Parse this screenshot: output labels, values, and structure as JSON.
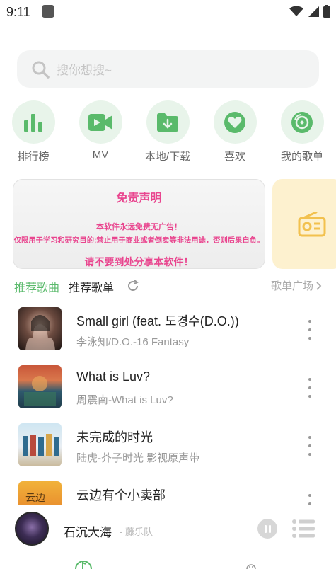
{
  "status_bar": {
    "time": "9:11"
  },
  "search": {
    "placeholder": "搜你想搜~"
  },
  "quick_actions": [
    {
      "label": "排行榜",
      "icon": "bar-chart-icon"
    },
    {
      "label": "MV",
      "icon": "video-camera-icon"
    },
    {
      "label": "本地/下载",
      "icon": "download-folder-icon"
    },
    {
      "label": "喜欢",
      "icon": "heart-icon"
    },
    {
      "label": "我的歌单",
      "icon": "playlist-disc-icon"
    }
  ],
  "banner": {
    "title": "免责声明",
    "line1": "本软件永远免费无广告！",
    "line2": "仅限用于学习和研究目的;禁止用于商业或者倒卖等非法用途，否则后果自负。",
    "footer": "请不要到处分享本软件！"
  },
  "section": {
    "tab_songs": "推荐歌曲",
    "tab_playlists": "推荐歌单",
    "more": "歌单广场"
  },
  "songs": [
    {
      "title": "Small girl (feat. 도경수(D.O.))",
      "subtitle": "李泳知/D.O.-16 Fantasy"
    },
    {
      "title": "What is Luv?",
      "subtitle": "周震南-What is Luv?"
    },
    {
      "title": "未完成的时光",
      "subtitle": "陆虎-芥子时光 影视原声带"
    },
    {
      "title": "云边有个小卖部",
      "subtitle": ""
    }
  ],
  "player": {
    "title": "石沉大海",
    "artist": "- 藤乐队"
  },
  "colors": {
    "accent": "#5aba6b",
    "accent_light": "#e8f4ea",
    "banner_text": "#e9468f"
  }
}
